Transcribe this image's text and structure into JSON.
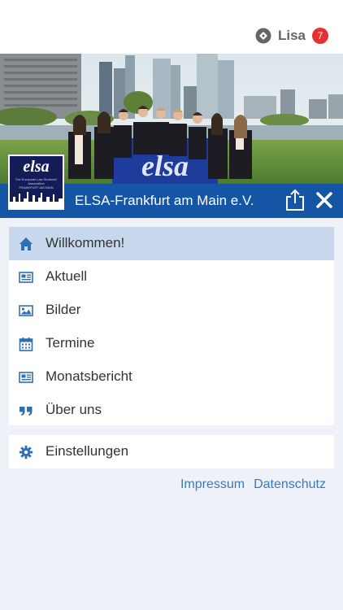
{
  "user": {
    "name": "Lisa",
    "badge_count": "7",
    "icon": "user-logo-icon"
  },
  "hero": {
    "icon": "group-photo"
  },
  "logo": {
    "text": "elsa",
    "subline1": "The European Law Students' Association",
    "subline2": "FRANKFURT AM MAIN"
  },
  "header": {
    "title": "ELSA-Frankfurt am Main e.V.",
    "share_icon": "share-icon",
    "close_icon": "close-icon"
  },
  "menu": {
    "items": [
      {
        "label": "Willkommen!",
        "icon": "home-icon",
        "active": true
      },
      {
        "label": "Aktuell",
        "icon": "newspaper-icon"
      },
      {
        "label": "Bilder",
        "icon": "image-icon"
      },
      {
        "label": "Termine",
        "icon": "calendar-icon"
      },
      {
        "label": "Monatsbericht",
        "icon": "newspaper-icon"
      },
      {
        "label": "Über uns",
        "icon": "quote-icon"
      }
    ]
  },
  "settings": {
    "label": "Einstellungen",
    "icon": "gear-icon"
  },
  "footer": {
    "impressum": "Impressum",
    "datenschutz": "Datenschutz"
  },
  "colors": {
    "brand_blue": "#1456a5",
    "active_item": "#c8d8ec",
    "icon_blue": "#2f6fb4",
    "link": "#3d78b8",
    "badge_red": "#e53030",
    "background": "#eef2f8"
  }
}
